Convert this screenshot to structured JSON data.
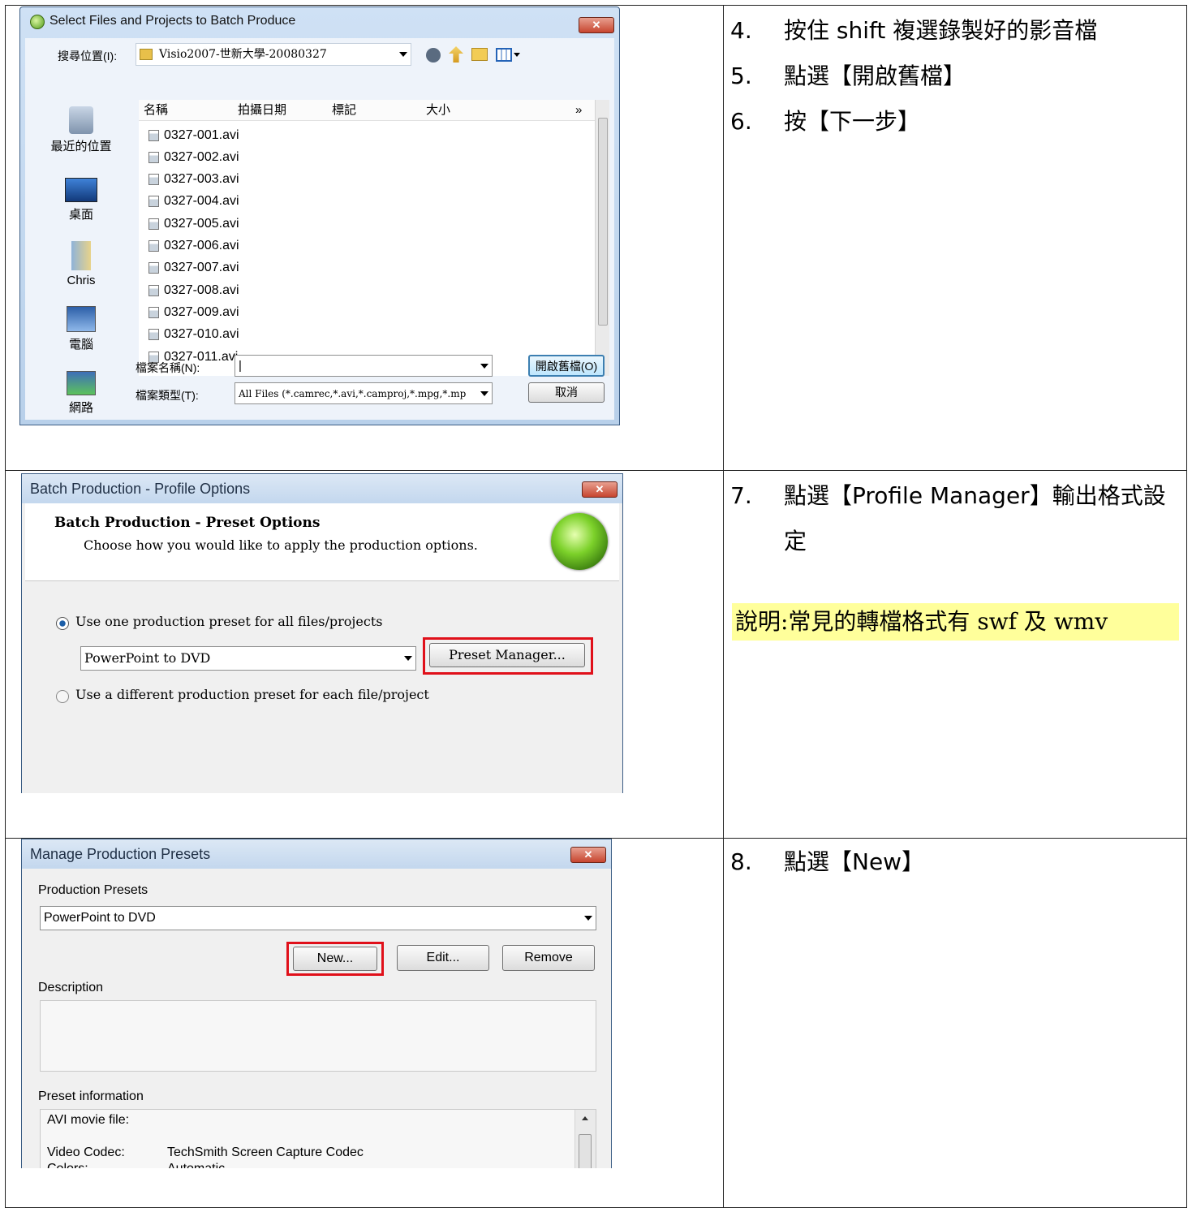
{
  "steps": {
    "block1": [
      {
        "num": "4.",
        "text": "按住 shift 複選錄製好的影音檔"
      },
      {
        "num": "5.",
        "text": "點選【開啟舊檔】"
      },
      {
        "num": "6.",
        "text": "按【下一步】"
      }
    ],
    "block2": [
      {
        "num": "7.",
        "text": "點選【Profile Manager】輸出格式設定"
      }
    ],
    "note": "說明:常見的轉檔格式有 swf 及 wmv",
    "block3": [
      {
        "num": "8.",
        "text": "點選【New】"
      }
    ]
  },
  "dialog1": {
    "title": "Select Files and Projects to Batch Produce",
    "close": "✕",
    "lookin_label": "搜尋位置(I):",
    "lookin_value": "Visio2007-世新大學-20080327",
    "columns": [
      "名稱",
      "拍攝日期",
      "標記",
      "大小",
      "»"
    ],
    "files": [
      "0327-001.avi",
      "0327-002.avi",
      "0327-003.avi",
      "0327-004.avi",
      "0327-005.avi",
      "0327-006.avi",
      "0327-007.avi",
      "0327-008.avi",
      "0327-009.avi",
      "0327-010.avi",
      "0327-011.avi"
    ],
    "places": [
      "最近的位置",
      "桌面",
      "Chris",
      "電腦",
      "網路"
    ],
    "filename_label": "檔案名稱(N):",
    "filename_value": "|",
    "filetype_label": "檔案類型(T):",
    "filetype_value": "All Files (*.camrec,*.avi,*.camproj,*.mpg,*.mp",
    "open_button": "開啟舊檔(O)",
    "cancel_button": "取消"
  },
  "dialog2": {
    "title": "Batch Production - Profile Options",
    "close": "✕",
    "heading": "Batch Production - Preset Options",
    "subheading": "Choose how you would like to apply the production options.",
    "radio1": "Use one production preset for all files/projects",
    "preset_value": "PowerPoint to DVD",
    "preset_manager_button": "Preset Manager...",
    "radio2": "Use a different production preset for each file/project"
  },
  "dialog3": {
    "title": "Manage Production Presets",
    "close": "✕",
    "presets_label": "Production Presets",
    "preset_value": "PowerPoint to DVD",
    "new_button": "New...",
    "edit_button": "Edit...",
    "remove_button": "Remove",
    "description_label": "Description",
    "info_label": "Preset information",
    "info_line1": "AVI movie file:",
    "codec_key": "Video Codec:",
    "codec_value": "TechSmith Screen Capture Codec",
    "colors_key": "Colors:",
    "colors_value": "Automatic"
  },
  "colors": {
    "highlight": "#ffff9b",
    "callout": "#e0101a"
  }
}
